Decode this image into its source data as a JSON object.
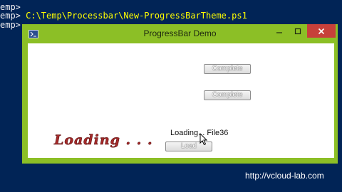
{
  "console": {
    "lines": [
      {
        "prompt": "emp>",
        "cmd": ""
      },
      {
        "prompt": "emp>",
        "cmd": " C:\\Temp\\Processbar\\New-ProgressBarTheme.ps1"
      },
      {
        "prompt": "emp>",
        "cmd": ""
      }
    ]
  },
  "window": {
    "title": "ProgressBar Demo",
    "buttons": {
      "complete_1": "Complete",
      "complete_2": "Complete",
      "load": "Load"
    },
    "status_text": "Loading... File36",
    "loading_art_text": "Loading . . .",
    "icons": [
      "powershell-icon",
      "minimize-icon",
      "maximize-icon",
      "close-icon",
      "mouse-pointer-icon"
    ]
  },
  "watermark": "http://vcloud-lab.com",
  "colors": {
    "console_bg": "#012456",
    "command_text": "#ffff00",
    "window_frame": "#8cbf26",
    "close_button": "#c7403a",
    "loading_art": "#a52a2a"
  }
}
